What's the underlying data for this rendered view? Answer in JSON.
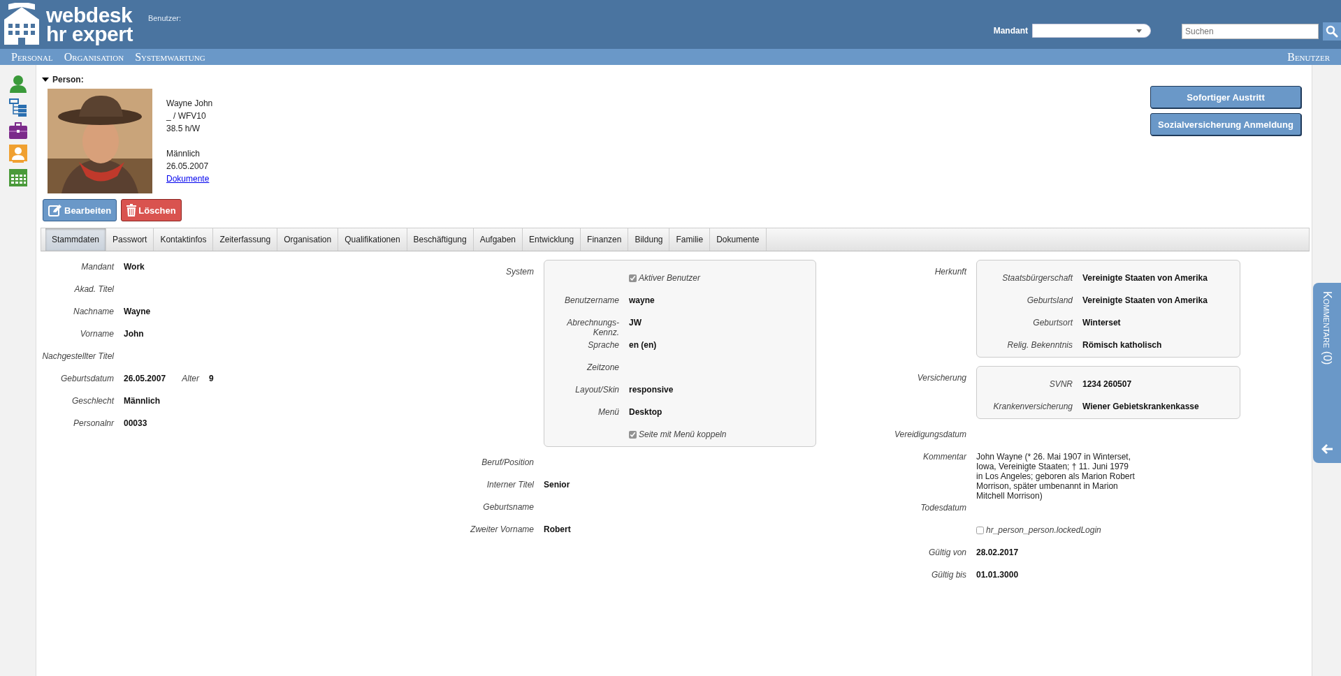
{
  "header": {
    "logo": {
      "line_1": "webdesk",
      "line_2": "hr expert"
    },
    "user_label": "Benutzer:",
    "mandant": {
      "label": "Mandant"
    },
    "search": {
      "placeholder": "Suchen"
    }
  },
  "nav": {
    "items": [
      "Personal",
      "Organisation",
      "Systemwartung"
    ],
    "right": "Benutzer"
  },
  "person": {
    "heading": "Person:",
    "expanded": true,
    "photo": {
      "kind": "picture"
    },
    "info": [
      [
        "Wayne John",
        "_ / WFV10",
        "38.5 h/W"
      ],
      [
        "Männlich",
        "26.05.2007"
      ]
    ],
    "documents_link": "Dokumente",
    "buttons": [
      {
        "label": "Bearbeiten",
        "kind": "edit"
      },
      {
        "label": "Löschen",
        "kind": "delete"
      }
    ]
  },
  "actions": [
    "Sofortiger Austritt",
    "Sozialversicherung Anmeldung"
  ],
  "tabs": [
    {
      "label": "Stammdaten",
      "selected": true
    },
    {
      "label": "Passwort",
      "selected": false
    },
    {
      "label": "Kontaktinfos",
      "selected": false
    },
    {
      "label": "Zeiterfassung",
      "selected": false
    },
    {
      "label": "Organisation",
      "selected": false
    },
    {
      "label": "Qualifikationen",
      "selected": false
    },
    {
      "label": "Beschäftigung",
      "selected": false
    },
    {
      "label": "Aufgaben",
      "selected": false
    },
    {
      "label": "Entwicklung",
      "selected": false
    },
    {
      "label": "Finanzen",
      "selected": false
    },
    {
      "label": "Bildung",
      "selected": false
    },
    {
      "label": "Familie",
      "selected": false
    },
    {
      "label": "Dokumente",
      "selected": false
    }
  ],
  "columns": [
    [
      {
        "kind": "field",
        "label": "Mandant",
        "value": "Work"
      },
      {
        "kind": "field",
        "label": "Akad. Titel"
      },
      {
        "kind": "field",
        "label": "Nachname",
        "value": "Wayne"
      },
      {
        "kind": "field",
        "label": "Vorname",
        "value": "John"
      },
      {
        "kind": "field",
        "label": "Nachgestellter Titel"
      },
      {
        "kind": "pair",
        "label": "Geburtsdatum",
        "value": "26.05.2007",
        "label_2": "Alter",
        "value_2": "9"
      },
      {
        "kind": "field",
        "label": "Geschlecht",
        "value": "Männlich"
      },
      {
        "kind": "field",
        "label": "Personalnr",
        "value": "00033"
      }
    ],
    [
      {
        "kind": "group",
        "label": "System",
        "fields": [
          {
            "kind": "checkbox",
            "label": "Aktiver Benutzer",
            "checked": true
          },
          {
            "kind": "field",
            "label": "Benutzername",
            "value": "wayne"
          },
          {
            "kind": "field",
            "label": "Abrechnungs-Kennz.",
            "value": "JW"
          },
          {
            "kind": "field",
            "label": "Sprache",
            "value": "en (en)"
          },
          {
            "kind": "field",
            "label": "Zeitzone"
          },
          {
            "kind": "field",
            "label": "Layout/Skin",
            "value": "responsive"
          },
          {
            "kind": "field",
            "label": "Menü",
            "value": "Desktop"
          },
          {
            "kind": "checkbox",
            "label": "Seite mit Menü koppeln",
            "checked": true
          }
        ]
      },
      {
        "kind": "field",
        "label": "Beruf/Position"
      },
      {
        "kind": "field",
        "label": "Interner Titel",
        "value": "Senior"
      },
      {
        "kind": "field",
        "label": "Geburtsname"
      },
      {
        "kind": "field",
        "label": "Zweiter Vorname",
        "value": "Robert"
      }
    ],
    [
      {
        "kind": "group",
        "label": "Herkunft",
        "fields": [
          {
            "kind": "field",
            "label": "Staatsbürgerschaft",
            "value": "Vereinigte Staaten von Amerika"
          },
          {
            "kind": "field",
            "label": "Geburtsland",
            "value": "Vereinigte Staaten von Amerika"
          },
          {
            "kind": "field",
            "label": "Geburtsort",
            "value": "Winterset"
          },
          {
            "kind": "field",
            "label": "Relig. Bekenntnis",
            "value": "Römisch katholisch"
          }
        ]
      },
      {
        "kind": "group",
        "label": "Versicherung",
        "fields": [
          {
            "kind": "field",
            "label": "SVNR",
            "value": "1234 260507"
          },
          {
            "kind": "field",
            "label": "Krankenversicherung",
            "value": "Wiener Gebietskrankenkasse"
          }
        ]
      },
      {
        "kind": "field",
        "label": "Vereidigungsdatum"
      },
      {
        "kind": "text",
        "label": "Kommentar",
        "lines": [
          "John Wayne (* 26. Mai 1907 in Winterset,",
          "Iowa, Vereinigte Staaten; † 11. Juni 1979",
          "in Los Angeles; geboren als Marion Robert",
          "Morrison, später umbenannt in Marion",
          "Mitchell Morrison)"
        ]
      },
      {
        "kind": "field",
        "label": "Todesdatum"
      },
      {
        "kind": "checkbox",
        "label": "hr_person_person.lockedLogin",
        "checked": false
      },
      {
        "kind": "field",
        "label": "Gültig von",
        "value": "28.02.2017"
      },
      {
        "kind": "field",
        "label": "Gültig bis",
        "value": "01.01.3000"
      }
    ]
  ],
  "comments_tab": {
    "label": "Kommentare (0)"
  }
}
